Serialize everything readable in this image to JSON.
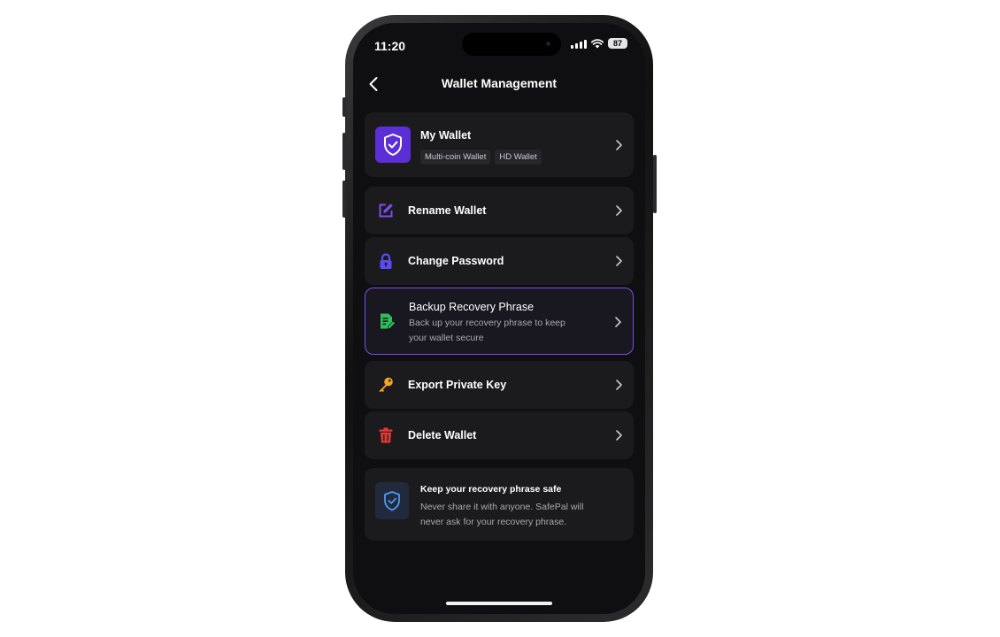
{
  "status_bar": {
    "time": "11:20",
    "battery": "87"
  },
  "nav": {
    "title": "Wallet Management"
  },
  "wallet": {
    "name": "My Wallet",
    "tags": [
      "Multi-coin Wallet",
      "HD Wallet"
    ]
  },
  "menu": [
    {
      "label": "Rename Wallet",
      "icon": "edit-icon",
      "color": "#7c4df0"
    },
    {
      "label": "Change Password",
      "icon": "lock-icon",
      "color": "#5b4bf5"
    },
    {
      "label": "Backup Recovery Phrase",
      "subtitle": "Back up your recovery phrase to keep your wallet secure",
      "icon": "document-edit-icon",
      "color": "#2fbf5a",
      "selected": true
    },
    {
      "label": "Export Private Key",
      "icon": "key-icon",
      "color": "#f5a623"
    },
    {
      "label": "Delete Wallet",
      "icon": "trash-icon",
      "color": "#e53935"
    }
  ],
  "notice": {
    "title": "Keep your recovery phrase safe",
    "text": "Never share it with anyone. SafePal will never ask for your recovery phrase."
  },
  "colors": {
    "accent": "#7c4df0",
    "background": "#0f0f11",
    "card": "#1b1b1e"
  }
}
